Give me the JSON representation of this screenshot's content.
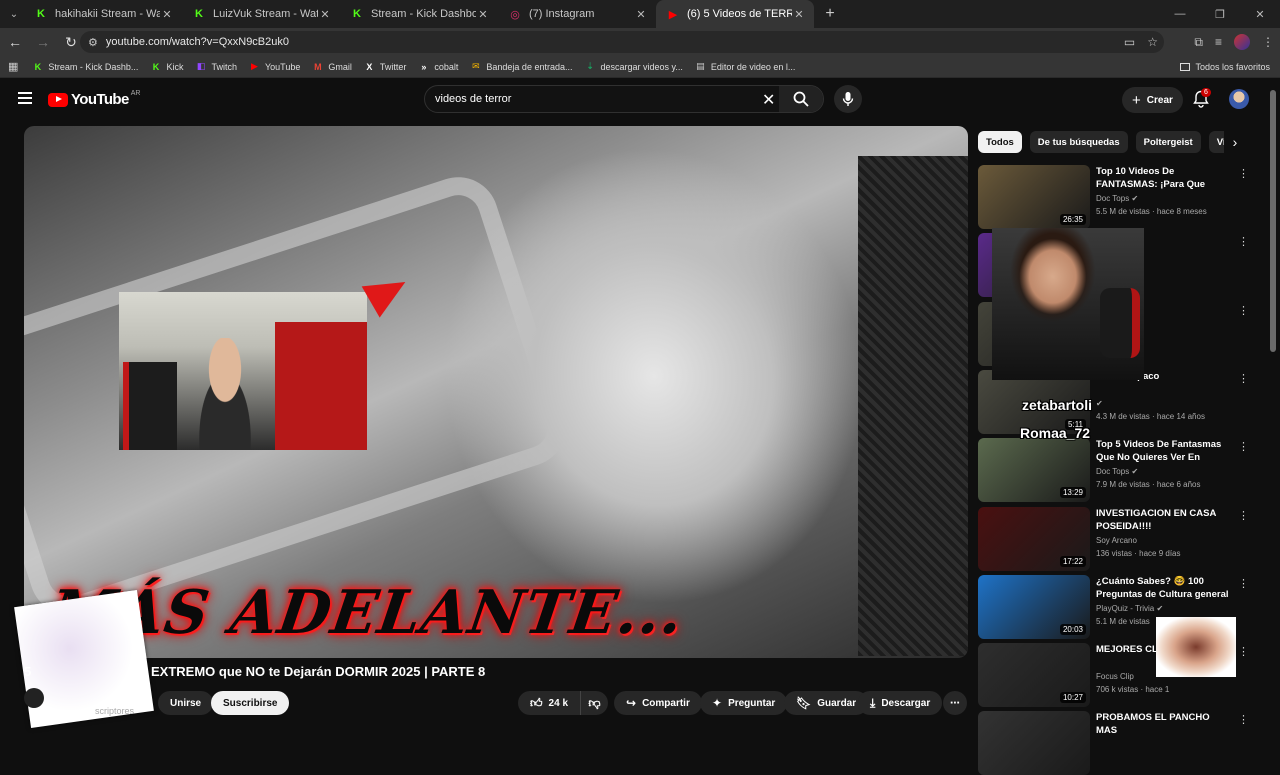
{
  "browser": {
    "tabs": [
      {
        "title": "hakihakii Stream - Watch Live o",
        "icon": "kick-icon",
        "color": "#53fc18"
      },
      {
        "title": "LuizVuk Stream - Watch Live on",
        "icon": "kick-icon",
        "color": "#53fc18"
      },
      {
        "title": "Stream - Kick Dashboard",
        "icon": "kick-icon",
        "color": "#53fc18"
      },
      {
        "title": "(7) Instagram",
        "icon": "instagram-icon",
        "color": "#e1306c"
      },
      {
        "title": "(6) 5 Videos de TERROR EXTREM",
        "icon": "youtube-icon",
        "color": "#ff0000",
        "active": true
      }
    ],
    "url": "youtube.com/watch?v=QxxN9cB2uk0",
    "bookmarks": [
      {
        "label": "Stream - Kick Dashb...",
        "icon": "kick-icon",
        "color": "#53fc18"
      },
      {
        "label": "Kick",
        "icon": "kick-icon",
        "color": "#53fc18"
      },
      {
        "label": "Twitch",
        "icon": "twitch-icon",
        "color": "#9146ff"
      },
      {
        "label": "YouTube",
        "icon": "youtube-icon",
        "color": "#ff0000"
      },
      {
        "label": "Gmail",
        "icon": "gmail-icon",
        "color": "#ea4335"
      },
      {
        "label": "Twitter",
        "icon": "x-icon",
        "color": "#ffffff"
      },
      {
        "label": "cobalt",
        "icon": "cobalt-icon",
        "color": "#ffffff"
      },
      {
        "label": "Bandeja de entrada...",
        "icon": "mail-icon",
        "color": "#f4b400"
      },
      {
        "label": "descargar videos y...",
        "icon": "download-site-icon",
        "color": "#1aa260"
      },
      {
        "label": "Editor de video en l...",
        "icon": "document-icon",
        "color": "#cccccc"
      }
    ],
    "all_bookmarks": "Todos los favoritos"
  },
  "youtube": {
    "logo_text": "YouTube",
    "country_code": "AR",
    "search_value": "videos de terror",
    "create_label": "Crear",
    "notifications_count": "6"
  },
  "video": {
    "title_prefix": "5",
    "title_main": "EXTREMO que NO te Dejarán DORMIR 2025 | PARTE 8",
    "overlay_text": "MÁS ADELANTE...",
    "subscribers_label": "scriptores",
    "join_label": "Unirse",
    "subscribe_label": "Suscribirse",
    "likes": "24 k",
    "share_label": "Compartir",
    "ask_label": "Preguntar",
    "save_label": "Guardar",
    "download_label": "Descargar"
  },
  "chips": [
    {
      "label": "Todos",
      "selected": true
    },
    {
      "label": "De tus búsquedas"
    },
    {
      "label": "Poltergeist"
    },
    {
      "label": "Vid"
    }
  ],
  "recommendations": [
    {
      "title": "Top 10 Videos De FANTASMAS: ¡Para Que LLORES!",
      "channel": "Doc Tops",
      "verified": true,
      "meta": "5.5 M de vistas · hace 8 meses",
      "duration": "26:35",
      "bg": "#6b5a3a"
    },
    {
      "title": "",
      "channel": "",
      "meta": "",
      "duration": "",
      "bg": "#5a2a8a",
      "covered": true
    },
    {
      "title": "",
      "channel": "",
      "meta": "",
      "duration": "",
      "bg": "#44443a",
      "covered": true
    },
    {
      "title": "dosis de paco",
      "channel": "",
      "verified": true,
      "meta": "4.3 M de vistas · hace 14 años",
      "duration": "5:11",
      "bg": "#4a4a40"
    },
    {
      "title": "Top 5 Videos De Fantasmas Que No Quieres Ver En Pantall...",
      "channel": "Doc Tops",
      "verified": true,
      "meta": "7.9 M de vistas · hace 6 años",
      "duration": "13:29",
      "bg": "#5b6a4e"
    },
    {
      "title": "INVESTIGACION EN CASA POSEIDA!!!!",
      "channel": "Soy Arcano",
      "meta": "136 vistas · hace 9 días",
      "duration": "17:22",
      "bg": "#4a1010"
    },
    {
      "title": "¿Cuánto Sabes? 🤓 100 Preguntas de Cultura general ...",
      "channel": "PlayQuiz - Trivia",
      "verified": true,
      "meta": "5.1 M de vistas",
      "duration": "20:03",
      "bg": "#1e73c8"
    },
    {
      "title": "MEJORES CLI",
      "channel": "Focus Clip",
      "meta": "706 k vistas · hace 1",
      "duration": "10:27",
      "bg": "#2e2e2e"
    },
    {
      "title": "PROBAMOS EL PANCHO MAS",
      "channel": "",
      "meta": "",
      "duration": "",
      "bg": "#333"
    }
  ],
  "stream_overlays": {
    "chat_name_1": "zetabartoli",
    "chat_name_2": "Romaa_72"
  }
}
